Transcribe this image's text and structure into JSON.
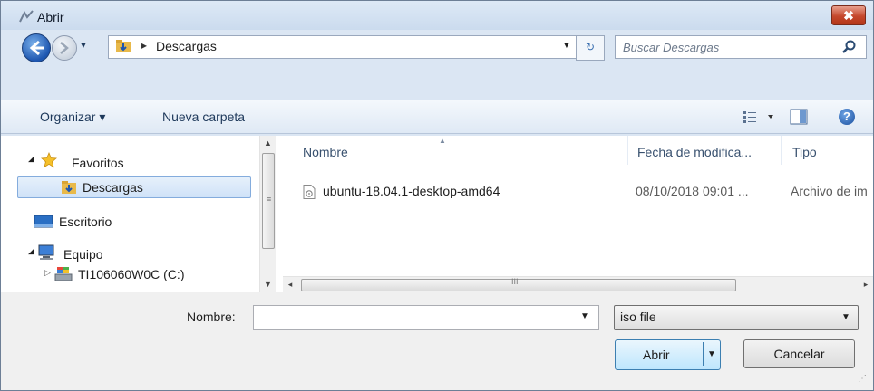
{
  "window": {
    "title": "Abrir",
    "close_glyph": "✖"
  },
  "address": {
    "separator": "▸",
    "crumb": "Descargas",
    "dropdown": "▼",
    "refresh_glyph": "↻"
  },
  "search": {
    "placeholder": "Buscar Descargas"
  },
  "toolbar": {
    "organize": "Organizar ▾",
    "new_folder": "Nueva carpeta",
    "help_glyph": "?"
  },
  "nav": {
    "items": [
      {
        "label": "Favoritos",
        "expander": "◢",
        "icon": "star-icon"
      },
      {
        "label": "Descargas",
        "icon": "downloads-folder-icon",
        "selected": true
      },
      {
        "label": "Escritorio",
        "icon": "desktop-icon"
      },
      {
        "label": "Equipo",
        "expander": "◢",
        "icon": "computer-icon"
      },
      {
        "label": "TI106060W0C (C:)",
        "expander": "▷",
        "icon": "drive-icon"
      }
    ],
    "scroll_up": "▲",
    "scroll_down": "▼",
    "grip": "≡"
  },
  "files": {
    "columns": [
      "Nombre",
      "Fecha de modifica...",
      "Tipo"
    ],
    "sort_glyph": "▲",
    "rows": [
      {
        "name": "ubuntu-18.04.1-desktop-amd64",
        "date": "08/10/2018 09:01 ...",
        "type": "Archivo de im"
      }
    ],
    "scroll_left": "◂",
    "scroll_right": "▸",
    "grip": "III"
  },
  "footer": {
    "filename_label": "Nombre:",
    "filename_value": "",
    "filename_drop": "▼",
    "filter_value": "iso file",
    "filter_drop": "▼",
    "open_label": "Abrir",
    "open_arrow": "▼",
    "cancel_label": "Cancelar",
    "grip": "⋰"
  },
  "colors": {
    "frame": "#dbe6f3",
    "accent": "#3c7fb1",
    "close": "#c5482d"
  }
}
